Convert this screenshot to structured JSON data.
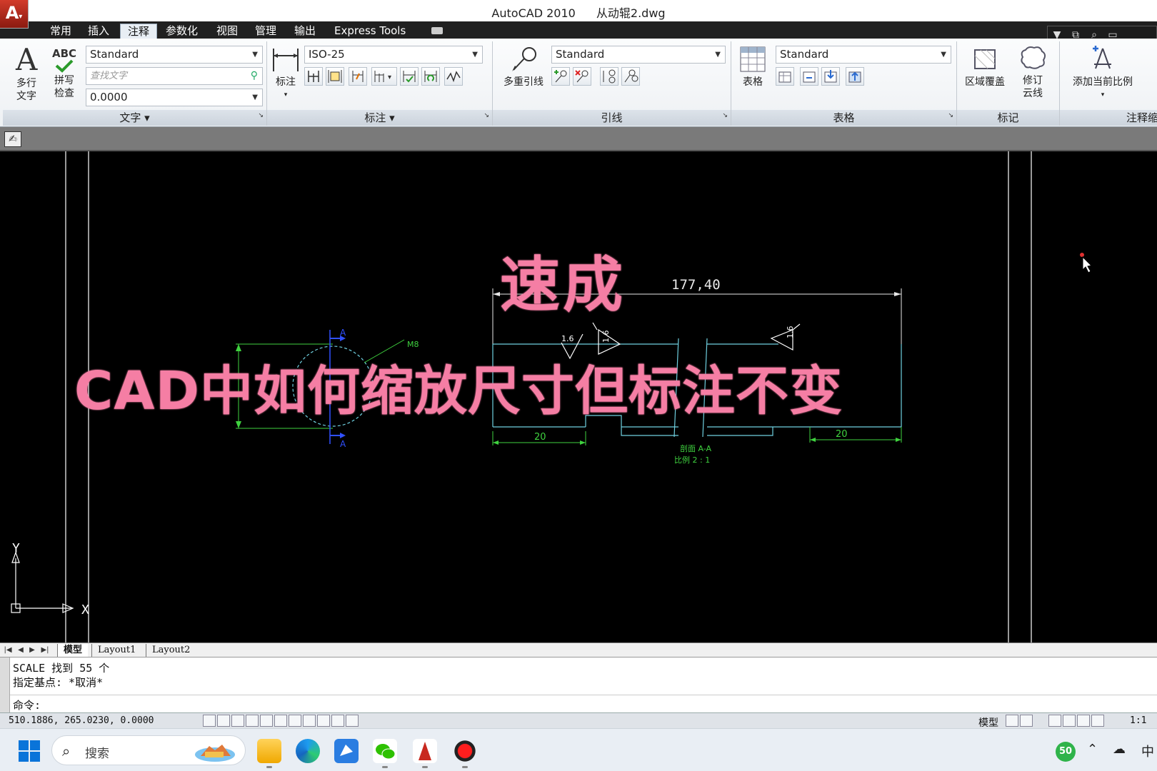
{
  "window": {
    "app_name": "AutoCAD 2010",
    "file_name": "从动辊2.dwg"
  },
  "ribbon_tabs": [
    "常用",
    "插入",
    "注释",
    "参数化",
    "视图",
    "管理",
    "输出",
    "Express Tools"
  ],
  "active_tab": "注释",
  "ribbon": {
    "text_panel": {
      "title": "文字",
      "mtext_label_1": "多行",
      "mtext_label_2": "文字",
      "spell_icon_text": "ABC",
      "spell_label_1": "拼写",
      "spell_label_2": "检查",
      "style_value": "Standard",
      "find_placeholder": "查找文字",
      "height_value": "0.0000"
    },
    "dim_panel": {
      "title": "标注",
      "dim_label": "标注",
      "style_value": "ISO-25"
    },
    "leader_panel": {
      "title": "引线",
      "mleader_label": "多重引线",
      "style_value": "Standard"
    },
    "table_panel": {
      "title": "表格",
      "table_label": "表格",
      "style_value": "Standard"
    },
    "markup_panel": {
      "title": "标记",
      "wipeout_label": "区域覆盖",
      "revcloud_label_1": "修订",
      "revcloud_label_2": "云线"
    },
    "scale_panel": {
      "title": "注释缩",
      "add_scale_label": "添加当前比例"
    }
  },
  "drawing": {
    "dim_overall": "177,40",
    "dim_left": "20",
    "dim_right": "20",
    "roughness_1": "1.6",
    "roughness_2": "1.6",
    "roughness_3": "1.6",
    "section_label_1": "剖面 A-A",
    "section_label_2": "比例 2 : 1",
    "thread_label": "M8",
    "section_mark": "A",
    "axis_x": "X",
    "axis_y": "Y"
  },
  "overlay": {
    "headline": "速成",
    "subtitle": "CAD中如何缩放尺寸但标注不变",
    "color": "#f57ea4"
  },
  "layout_tabs": [
    "模型",
    "Layout1",
    "Layout2"
  ],
  "active_layout": "模型",
  "command_window": {
    "history_1": "SCALE 找到 55 个",
    "history_2": "指定基点: *取消*",
    "prompt": "命令:"
  },
  "status_bar": {
    "coordinates": "510.1886,  265.0230,  0.0000",
    "space_label": "模型",
    "annotation_scale": "1:1"
  },
  "taskbar": {
    "search_placeholder": "搜索",
    "tray_badge": "50",
    "ime_label": "中",
    "apps": [
      "file-explorer",
      "edge",
      "feishu",
      "wechat",
      "autocad",
      "screen-recorder"
    ]
  },
  "colors": {
    "cad_background": "#000000",
    "dimension_green": "#3fd23f",
    "geometry_cyan": "#6fd0e0",
    "section_blue": "#3050ff",
    "overlay_pink": "#f57ea4"
  }
}
